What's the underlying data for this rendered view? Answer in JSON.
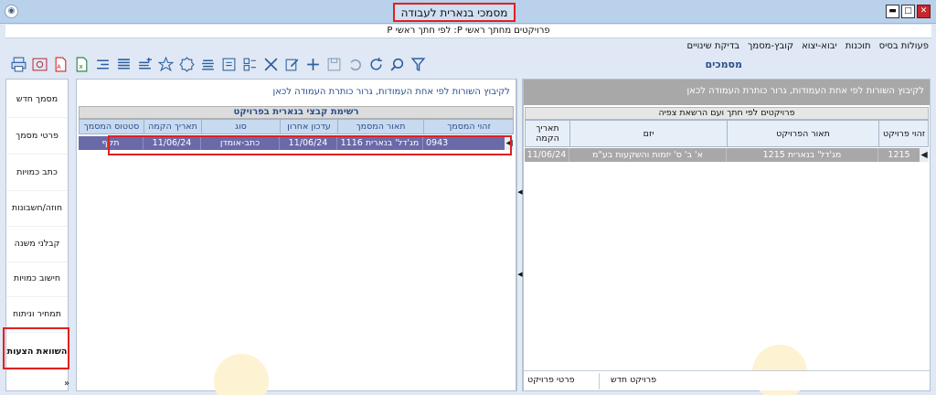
{
  "window": {
    "title": "מסמכי בנארית לעבודה",
    "subtitle": "פרויקטים מחתך ראשי P: לפי חתך ראשי P"
  },
  "menu": [
    "פעולות בסיס",
    "תוכנות",
    "יבוא-יצוא",
    "קובץ-מסמך",
    "בדיקת שינויים"
  ],
  "section_title": "מסמכים",
  "toolbar_icons": [
    "print-icon",
    "preview-icon",
    "pdf-icon",
    "excel-icon",
    "indent-icon",
    "list-icon",
    "list-add-icon",
    "star-icon",
    "badge-icon",
    "align-icon",
    "form-icon",
    "layout-icon",
    "cross-tools-icon",
    "edit-icon",
    "plus-icon",
    "save-icon",
    "undo-icon",
    "refresh-icon",
    "search-icon",
    "filter-icon"
  ],
  "sidebar": [
    "מסמך חדש",
    "פרטי מסמך",
    "כתב כמויות",
    "חוזה/חשבונות",
    "קבלני משנה",
    "חישוב כמויות",
    "תמחיר וניתוח",
    "השוואת הצעות"
  ],
  "sidebar_more": "»",
  "left_panel": {
    "hint": "לקיבוץ השורות לפי אחת העמודות, גרור כותרת העמודה לכאן",
    "caption": "רשימת קבצי בנארית בפרויקט",
    "columns": [
      "זהוי המסמך",
      "תאור המסמך",
      "עדכון אחרון",
      "סוג",
      "תאריך הקמה",
      "סטטוס המסמך"
    ],
    "row": [
      "0943",
      "מג'דל' בנארית 1116",
      "11/06/24",
      "כתב-אומדן",
      "11/06/24",
      "תקף"
    ]
  },
  "right_panel": {
    "hint": "לקיבוץ השורות לפי אחת העמודות, גרור כותרת העמודה לכאן",
    "caption": "פרויקטים לפי חתך ועם הרשאת צפיה",
    "columns": [
      "זהוי פרויקט",
      "תאור הפרויקט",
      "יזם",
      "תאריך הקמה"
    ],
    "row": [
      "1215",
      "מג'דל' בנארית 1215",
      "א' ב' ס' יזמות והשקעות בע\"מ",
      "11/06/24"
    ],
    "footer": [
      "פרויקט חדש",
      "פרטי פרויקט"
    ]
  },
  "colors": {
    "titlebar": "#b9d1ea",
    "highlight": "#e02020",
    "selected_row": "#6a6aa8",
    "accent_text": "#2a4f8a"
  }
}
